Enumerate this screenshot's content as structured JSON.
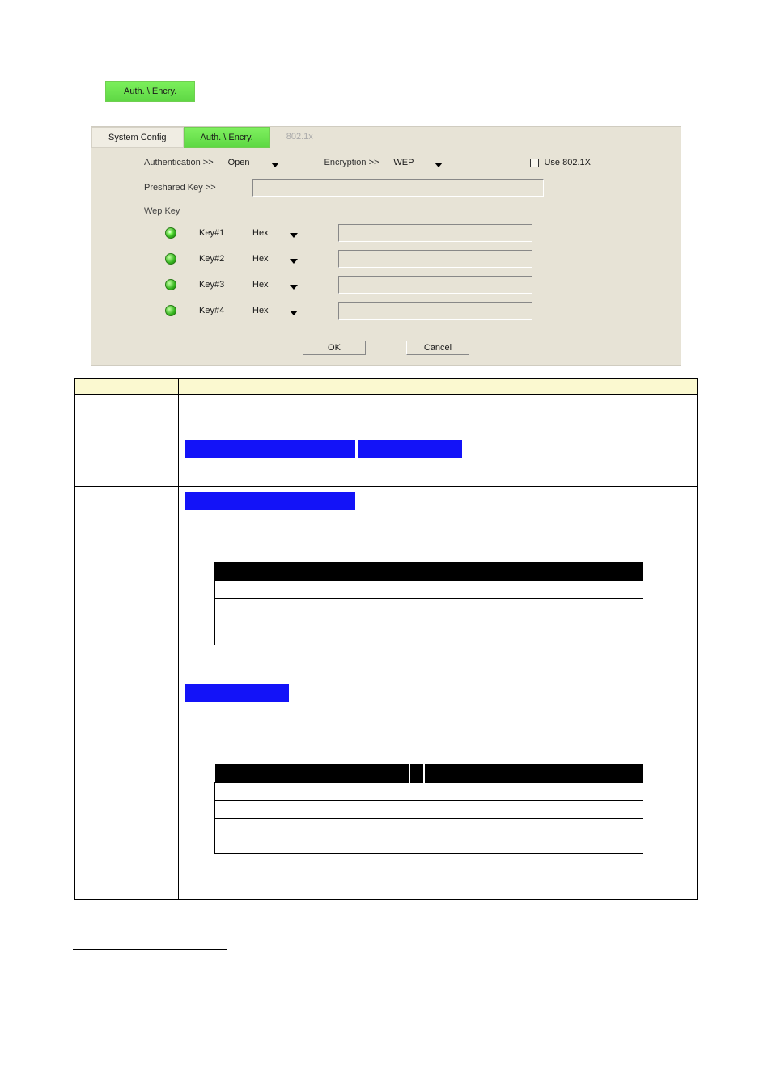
{
  "standalone_tab": "Auth. \\ Encry.",
  "tabs": {
    "system_config": "System Config",
    "auth_encry": "Auth. \\ Encry.",
    "x8021": "802.1x"
  },
  "labels": {
    "authentication": "Authentication >>",
    "encryption": "Encryption >>",
    "use8021x": "Use 802.1X",
    "preshared": "Preshared Key >>",
    "wepkey": "Wep Key"
  },
  "values": {
    "auth": "Open",
    "encryption": "WEP",
    "hex": "Hex"
  },
  "keys": {
    "k1": "Key#1",
    "k2": "Key#2",
    "k3": "Key#3",
    "k4": "Key#4"
  },
  "buttons": {
    "ok": "OK",
    "cancel": "Cancel"
  }
}
